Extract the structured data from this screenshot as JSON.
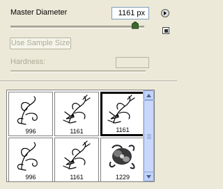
{
  "master_diameter": {
    "label": "Master Diameter",
    "value": "1161 px",
    "slider_fraction": 0.93
  },
  "use_sample_size_label": "Use Sample Size",
  "hardness": {
    "label": "Hardness:",
    "value": ""
  },
  "brushes": [
    {
      "size": "996"
    },
    {
      "size": "1161"
    },
    {
      "size": "1161",
      "selected": true
    },
    {
      "size": "996"
    },
    {
      "size": "1161"
    },
    {
      "size": "1229"
    }
  ],
  "icons": {
    "menu": "flyout-menu-icon",
    "new_preset": "new-preset-icon"
  }
}
